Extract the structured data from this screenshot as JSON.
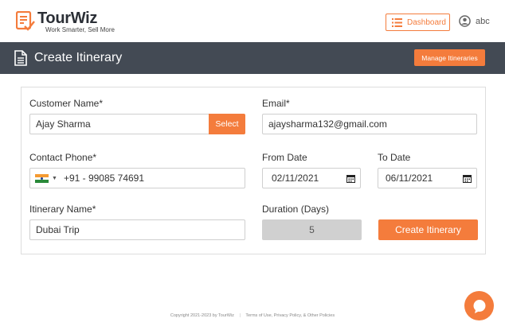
{
  "brand": {
    "name": "TourWiz",
    "tagline": "Work Smarter, Sell More"
  },
  "topbar": {
    "dashboard_label": "Dashboard",
    "username": "abc"
  },
  "header": {
    "title": "Create Itinerary",
    "manage_label": "Manage Itineraries"
  },
  "form": {
    "customer_name_label": "Customer Name",
    "customer_name_value": "Ajay Sharma",
    "select_label": "Select",
    "email_label": "Email",
    "email_value": "ajaysharma132@gmail.com",
    "contact_phone_label": "Contact Phone",
    "phone_value": "+91 - 99085 74691",
    "from_date_label": "From Date",
    "from_date_value": "02/11/2021",
    "to_date_label": "To Date",
    "to_date_value": "06/11/2021",
    "itinerary_name_label": "Itinerary Name",
    "itinerary_name_value": "Dubai Trip",
    "duration_label": "Duration (Days)",
    "duration_value": "5",
    "required_marker": "*",
    "create_label": "Create Itinerary"
  },
  "footer": {
    "copyright": "Copyright 2021-2023 by TourWiz",
    "separator": "|",
    "links": "Terms of Use, Privacy Policy, & Other Policies"
  },
  "colors": {
    "accent": "#f47c3c",
    "header_bg": "#434a54"
  },
  "icons": {
    "logo": "checklist-logo-icon",
    "dashboard": "list-icon",
    "user": "user-circle-icon",
    "document": "document-icon",
    "calendar": "calendar-icon",
    "chat": "chat-icon"
  }
}
